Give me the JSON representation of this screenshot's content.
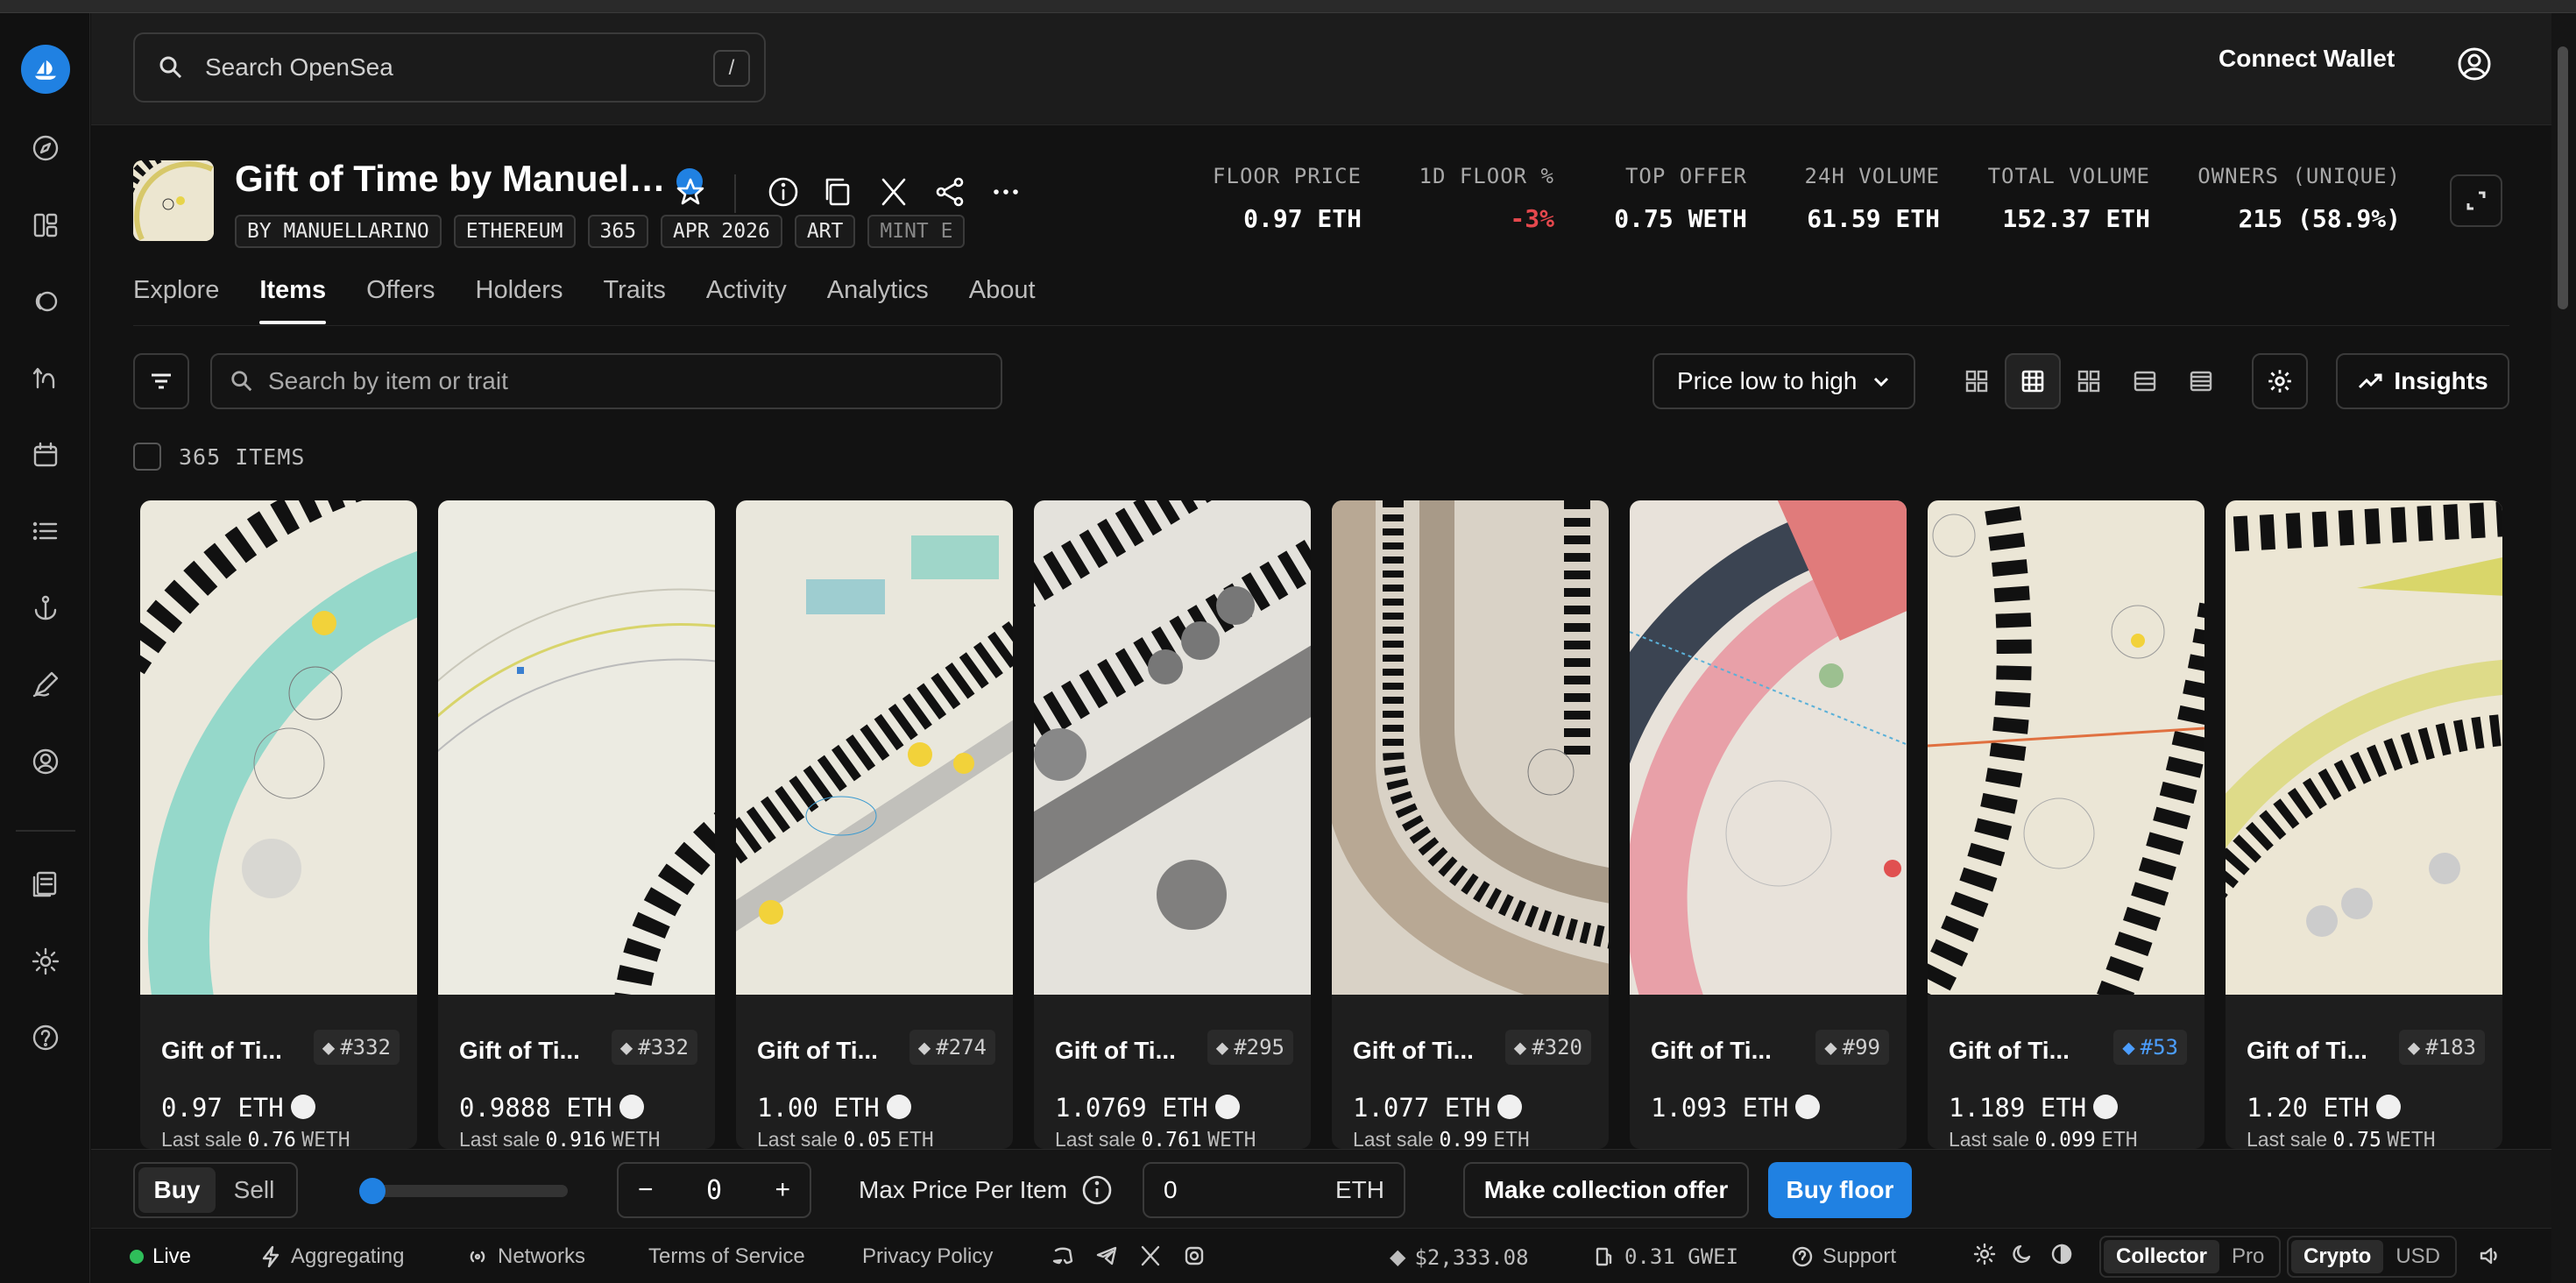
{
  "search": {
    "placeholder": "Search OpenSea",
    "shortcut": "/"
  },
  "header": {
    "connect_wallet": "Connect Wallet"
  },
  "collection": {
    "title": "Gift of Time by Manuel…",
    "tags": [
      "BY MANUELLARINO",
      "ETHEREUM",
      "365",
      "APR 2026",
      "ART",
      "MINT E"
    ]
  },
  "stats": [
    {
      "label": "FLOOR PRICE",
      "value": "0.97 ETH"
    },
    {
      "label": "1D FLOOR %",
      "value": "-3%"
    },
    {
      "label": "TOP OFFER",
      "value": "0.75 WETH"
    },
    {
      "label": "24H VOLUME",
      "value": "61.59 ETH"
    },
    {
      "label": "TOTAL VOLUME",
      "value": "152.37 ETH"
    },
    {
      "label": "OWNERS (UNIQUE)",
      "value": "215 (58.9%)"
    }
  ],
  "tabs": [
    "Explore",
    "Items",
    "Offers",
    "Holders",
    "Traits",
    "Activity",
    "Analytics",
    "About"
  ],
  "toolbar": {
    "search_placeholder": "Search by item or trait",
    "sort": "Price low to high",
    "insights": "Insights"
  },
  "items_count": "365 ITEMS",
  "items": [
    {
      "name": "Gift of Ti...",
      "id": "#332",
      "price": "0.97",
      "unit": "ETH",
      "last_label": "Last sale",
      "last_value": "0.76",
      "last_unit": "WETH",
      "accent": "#7fd3c6"
    },
    {
      "name": "Gift of Ti...",
      "id": "#332",
      "price": "0.9888",
      "unit": "ETH",
      "last_label": "Last sale",
      "last_value": "0.916",
      "last_unit": "WETH",
      "accent": "#d8d46a"
    },
    {
      "name": "Gift of Ti...",
      "id": "#274",
      "price": "1.00",
      "unit": "ETH",
      "last_label": "Last sale",
      "last_value": "0.05",
      "last_unit": "ETH",
      "accent": "#7fcfc0"
    },
    {
      "name": "Gift of Ti...",
      "id": "#295",
      "price": "1.0769",
      "unit": "ETH",
      "last_label": "Last sale",
      "last_value": "0.761",
      "last_unit": "WETH",
      "accent": "#777777"
    },
    {
      "name": "Gift of Ti...",
      "id": "#320",
      "price": "1.077",
      "unit": "ETH",
      "last_label": "Last sale",
      "last_value": "0.99",
      "last_unit": "ETH",
      "accent": "#b8a894"
    },
    {
      "name": "Gift of Ti...",
      "id": "#99",
      "price": "1.093",
      "unit": "ETH",
      "last_label": "",
      "last_value": "",
      "last_unit": "",
      "accent": "#e07b7b"
    },
    {
      "name": "Gift of Ti...",
      "id": "#53",
      "price": "1.189",
      "unit": "ETH",
      "last_label": "Last sale",
      "last_value": "0.099",
      "last_unit": "ETH",
      "accent": "#e07040"
    },
    {
      "name": "Gift of Ti...",
      "id": "#183",
      "price": "1.20",
      "unit": "ETH",
      "last_label": "Last sale",
      "last_value": "0.75",
      "last_unit": "WETH",
      "accent": "#d9d66a"
    }
  ],
  "bottom": {
    "buy": "Buy",
    "sell": "Sell",
    "qty": "0",
    "max_label": "Max Price Per Item",
    "max_value": "0",
    "max_unit": "ETH",
    "offer": "Make collection offer",
    "buy_floor": "Buy floor"
  },
  "footer": {
    "live": "Live",
    "aggregating": "Aggregating",
    "networks": "Networks",
    "terms": "Terms of Service",
    "privacy": "Privacy Policy",
    "eth_price": "$2,333.08",
    "gas": "0.31 GWEI",
    "support": "Support",
    "collector": "Collector",
    "pro": "Pro",
    "crypto": "Crypto",
    "usd": "USD"
  },
  "colors": {
    "accent": "#2081e2",
    "negative": "#e5484d",
    "live": "#2fbe5a"
  }
}
